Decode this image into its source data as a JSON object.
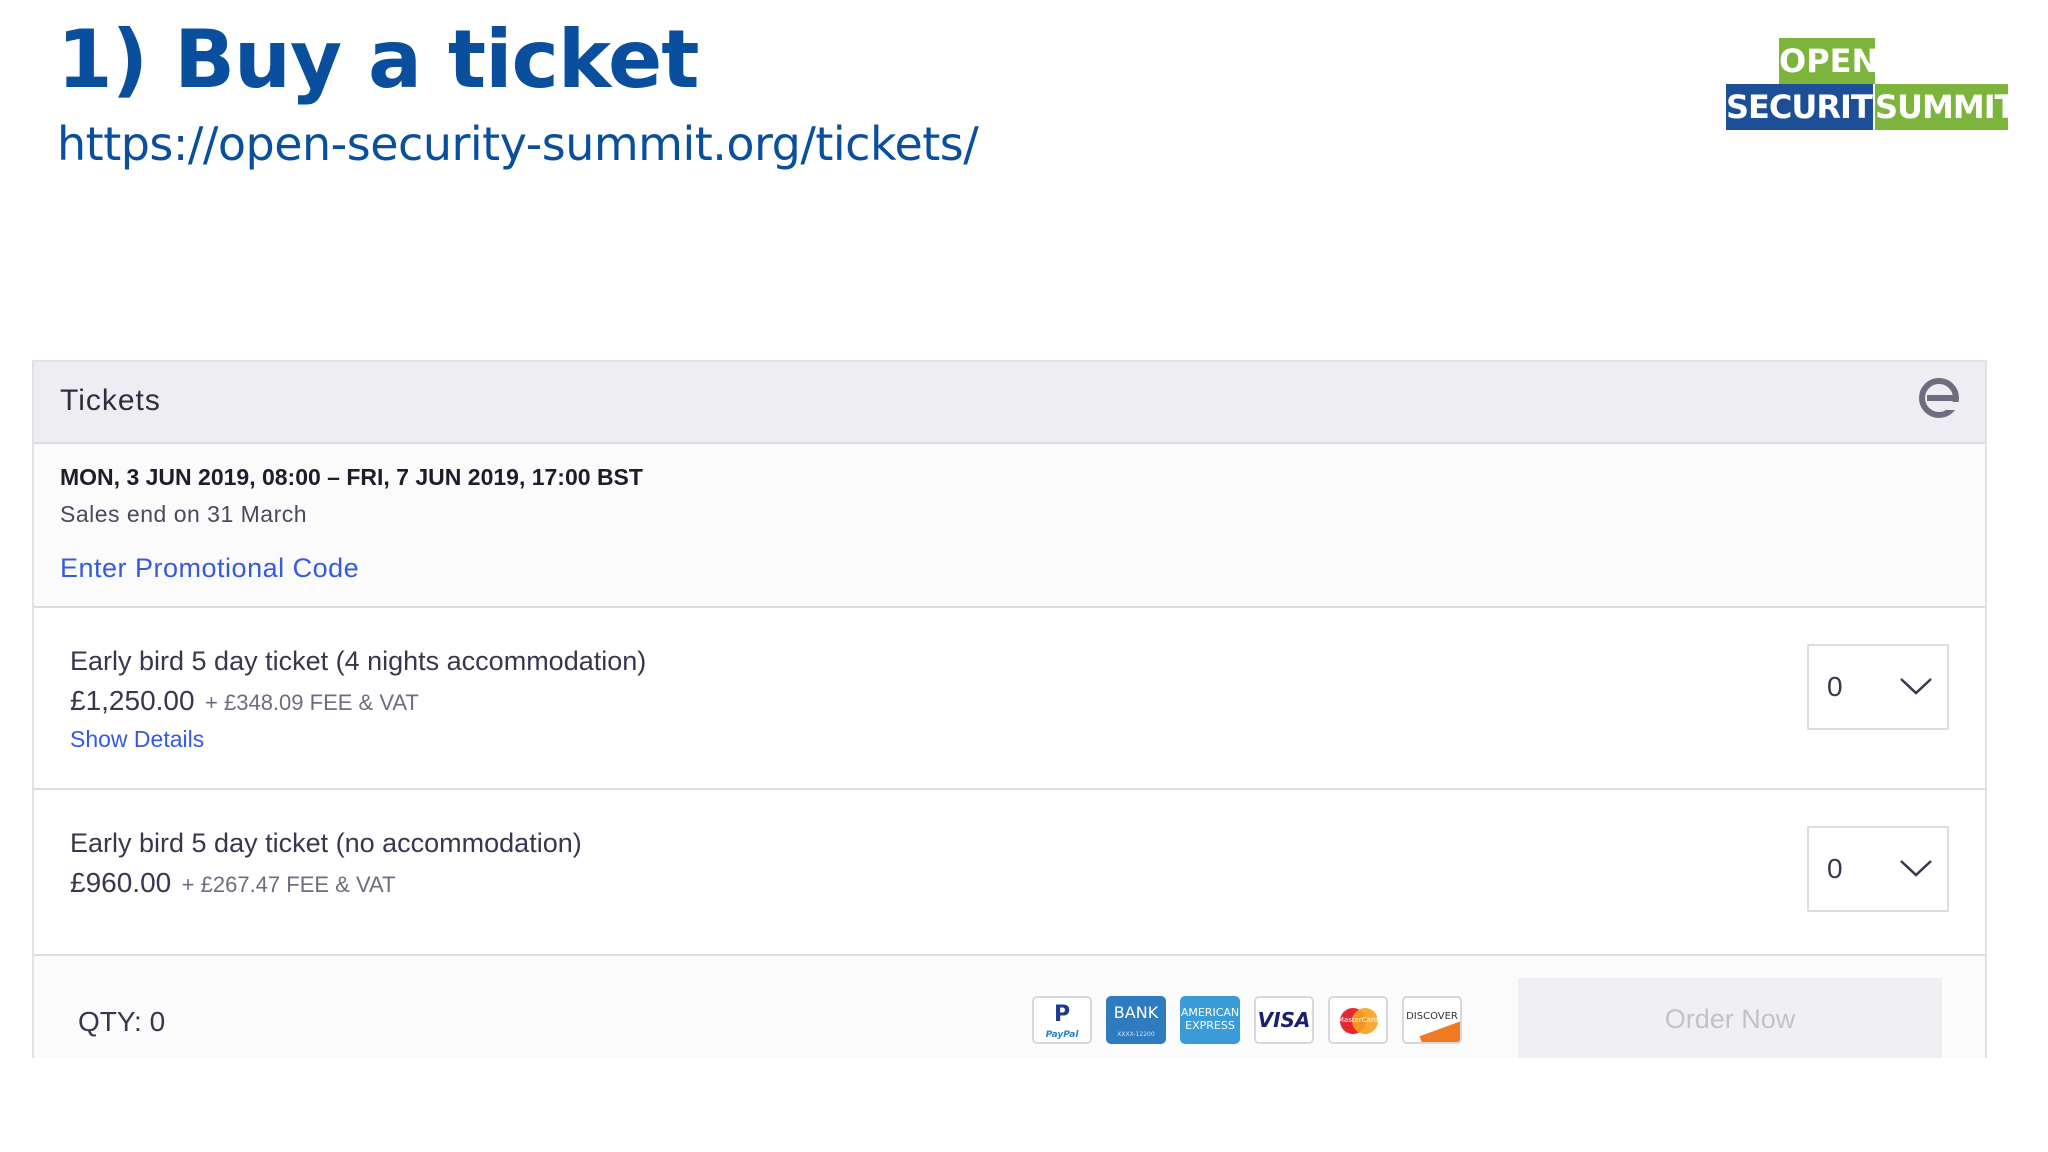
{
  "slide": {
    "title": "1) Buy a ticket",
    "url": "https://open-security-summit.org/tickets/"
  },
  "logo": {
    "line1": "OPEN",
    "line2a": "SECURITY",
    "line2b": "SUMMIT",
    "colors": {
      "green": "#7db53c",
      "blue": "#1c4f96"
    }
  },
  "widget": {
    "header": {
      "title": "Tickets",
      "brand_icon": "eventbrite-e-icon"
    },
    "event": {
      "dates": "MON, 3 JUN 2019, 08:00 – FRI, 7 JUN 2019, 17:00 BST",
      "sales_end": "Sales end on 31 March",
      "promo_link": "Enter Promotional Code"
    },
    "tickets": [
      {
        "name": "Early bird 5 day ticket (4 nights accommodation)",
        "price": "£1,250.00",
        "fee": "+ £348.09 FEE & VAT",
        "details_link": "Show Details",
        "quantity": "0"
      },
      {
        "name": "Early bird 5 day ticket (no accommodation)",
        "price": "£960.00",
        "fee": "+ £267.47 FEE & VAT",
        "quantity": "0"
      }
    ],
    "footer": {
      "qty_label": "QTY: 0",
      "payment_methods": [
        {
          "label": "P",
          "sub": "PayPal"
        },
        {
          "label": "BANK",
          "sub": "XXXX-12200"
        },
        {
          "label": "AMERICAN EXPRESS"
        },
        {
          "label": "VISA"
        },
        {
          "label": "MasterCard"
        },
        {
          "label": "DISCOVER"
        }
      ],
      "order_button": "Order Now"
    },
    "colors": {
      "link": "#3659e3",
      "text": "#39364f"
    }
  }
}
